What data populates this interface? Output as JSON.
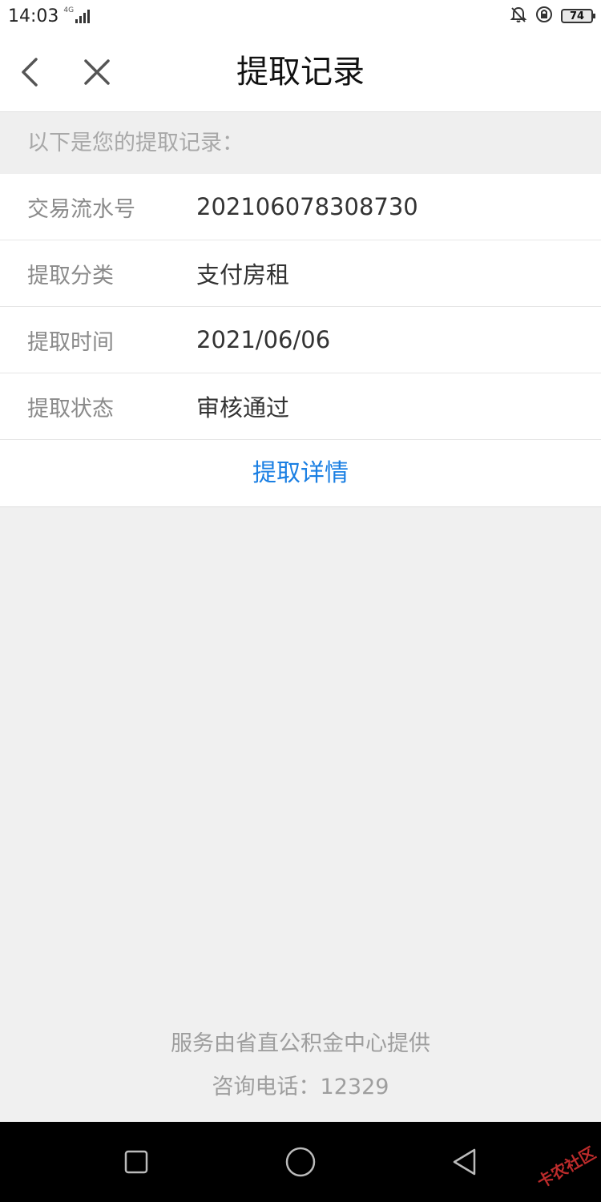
{
  "status_bar": {
    "time": "14:03",
    "network": "4G",
    "battery": "74",
    "icons": [
      "mute-bell-icon",
      "lock-rotation-icon",
      "battery-icon",
      "signal-icon"
    ]
  },
  "nav": {
    "title": "提取记录",
    "back_icon": "chevron-left-icon",
    "close_icon": "close-icon"
  },
  "hint": "以下是您的提取记录：",
  "record": {
    "rows": [
      {
        "label": "交易流水号",
        "value": "202106078308730"
      },
      {
        "label": "提取分类",
        "value": "支付房租"
      },
      {
        "label": "提取时间",
        "value": "2021/06/06"
      },
      {
        "label": "提取状态",
        "value": "审核通过"
      }
    ],
    "detail_link": "提取详情"
  },
  "footer": {
    "provider": "服务由省直公积金中心提供",
    "hotline": "咨询电话：12329"
  },
  "system_nav": {
    "buttons": [
      "recents-square-icon",
      "home-circle-icon",
      "back-triangle-icon"
    ]
  },
  "watermark": "卡农社区",
  "colors": {
    "link": "#1a7fe3",
    "background": "#f0f0f0",
    "label": "#8a8a8a"
  }
}
